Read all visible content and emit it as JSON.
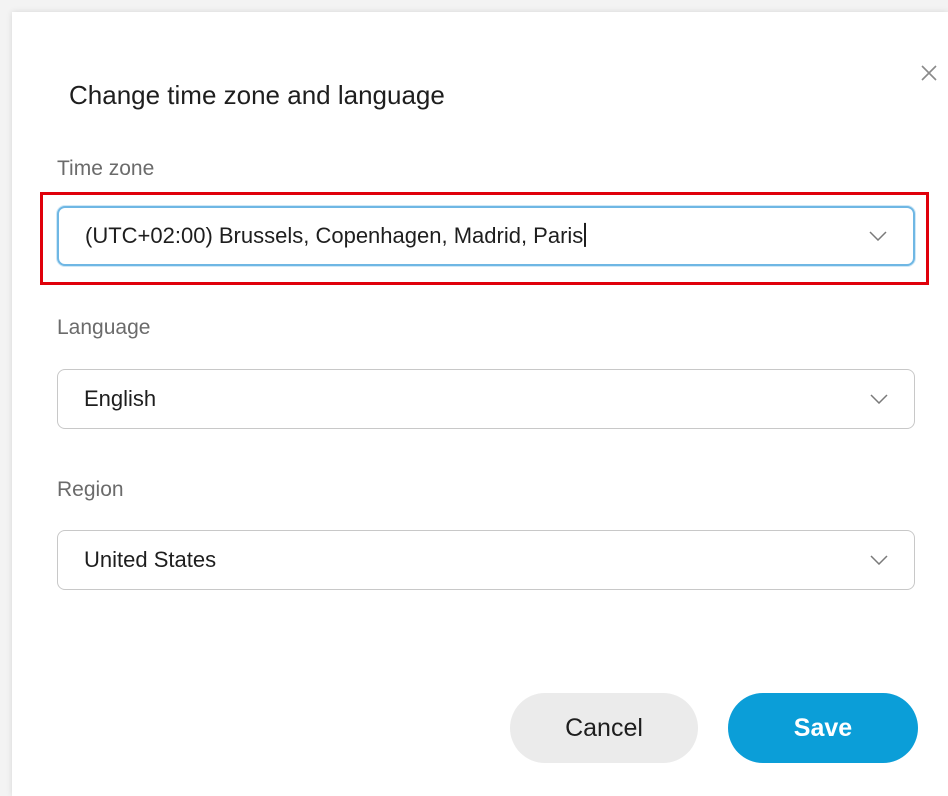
{
  "dialog": {
    "title": "Change time zone and language",
    "close_icon": "close-icon"
  },
  "fields": {
    "timezone": {
      "label": "Time zone",
      "value": "(UTC+02:00) Brussels, Copenhagen, Madrid, Paris"
    },
    "language": {
      "label": "Language",
      "value": "English"
    },
    "region": {
      "label": "Region",
      "value": "United States"
    }
  },
  "actions": {
    "cancel_label": "Cancel",
    "save_label": "Save"
  },
  "colors": {
    "accent": "#0b9ed8",
    "highlight": "#e0000a",
    "focus_border": "#6fb7e4"
  }
}
